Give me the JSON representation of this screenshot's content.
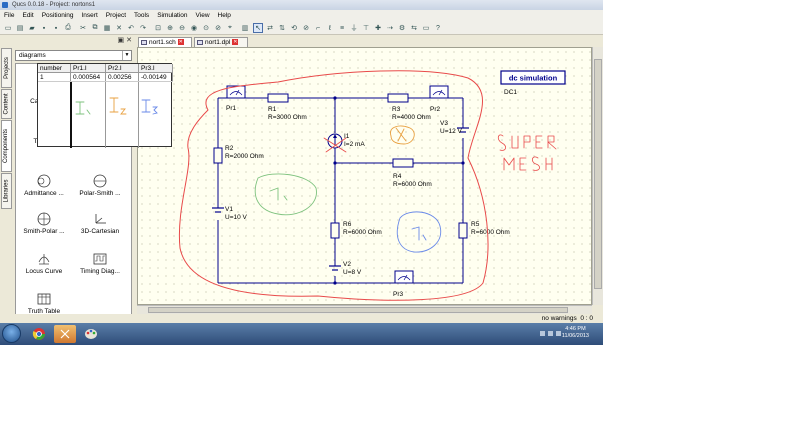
{
  "window": {
    "title": "Qucs 0.0.18 - Project: nortons1"
  },
  "menu": [
    "File",
    "Edit",
    "Positioning",
    "Insert",
    "Project",
    "Tools",
    "Simulation",
    "View",
    "Help"
  ],
  "side_tabs": [
    "Projects",
    "Content",
    "Components",
    "Libraries"
  ],
  "dock": {
    "combo_value": "diagrams",
    "items": [
      "Cartesian",
      "Tabular",
      "Admittance ...",
      "Polar-Smith ...",
      "Smith-Polar ...",
      "3D-Cartesian",
      "Locus Curve",
      "Timing Diag...",
      "Truth Table"
    ]
  },
  "doc_tabs": [
    {
      "label": "nort1.sch"
    },
    {
      "label": "nort1.dpl"
    }
  ],
  "results_table": {
    "headers": [
      "number",
      "Pr1.I",
      "Pr2.I",
      "Pr3.I"
    ],
    "row": [
      "1",
      "0.000564",
      "0.00256",
      "-0.00149"
    ]
  },
  "simulation": {
    "title": "dc simulation",
    "name": "DC1"
  },
  "schematic": {
    "pr1": "Pr1",
    "pr2": "Pr2",
    "pr3": "Pr3",
    "r1_name": "R1",
    "r1_val": "R=3000 Ohm",
    "r2_name": "R2",
    "r2_val": "R=2000 Ohm",
    "r3_name": "R3",
    "r3_val": "R=4000 Ohm",
    "r4_name": "R4",
    "r4_val": "R=6000 Ohm",
    "r5_name": "R5",
    "r5_val": "R=6000 Ohm",
    "r6_name": "R6",
    "r6_val": "R=6000 Ohm",
    "v1_name": "V1",
    "v1_val": "U=10 V",
    "v2_name": "V2",
    "v2_val": "U=8 V",
    "v3_name": "V3",
    "v3_val": "U=12 V",
    "i1_name": "I1",
    "i1_val": "I=2 mA"
  },
  "status": {
    "warnings": "no warnings",
    "position": "0 : 0"
  },
  "clock": {
    "time": "4:46 PM",
    "date": "11/06/2013"
  },
  "colors": {
    "wire": "#00008b",
    "annotation_red": "#e84a4a",
    "annotation_green": "#7ec27e",
    "annotation_blue": "#6a8ae8",
    "annotation_orange": "#e8a040"
  }
}
